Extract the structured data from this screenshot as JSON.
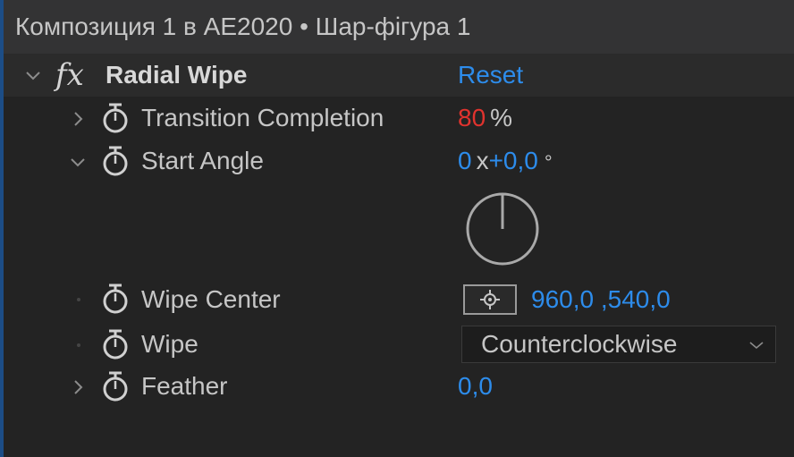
{
  "window": {
    "title": "Композиция 1 в AE2020 • Шар-фігура 1"
  },
  "effect": {
    "name": "Radial Wipe",
    "fx_symbol": "fx",
    "reset_label": "Reset"
  },
  "properties": {
    "transition_completion": {
      "label": "Transition Completion",
      "value": "80",
      "unit": "%"
    },
    "start_angle": {
      "label": "Start Angle",
      "revolutions": "0",
      "separator": "x",
      "degrees": "+0,0",
      "unit": "°",
      "dial_angle_degrees": 0
    },
    "wipe_center": {
      "label": "Wipe Center",
      "value": "960,0 ,540,0"
    },
    "wipe": {
      "label": "Wipe",
      "selected": "Counterclockwise"
    },
    "feather": {
      "label": "Feather",
      "value": "0,0"
    }
  },
  "colors": {
    "value_blue": "#2d8ceb",
    "value_red": "#e0332e",
    "panel_bg": "#232323",
    "title_bg": "#333334"
  },
  "icons": [
    "chevron-down-icon",
    "chevron-right-icon",
    "fx-icon",
    "stopwatch-icon",
    "angle-dial-icon",
    "crosshair-target-icon"
  ]
}
